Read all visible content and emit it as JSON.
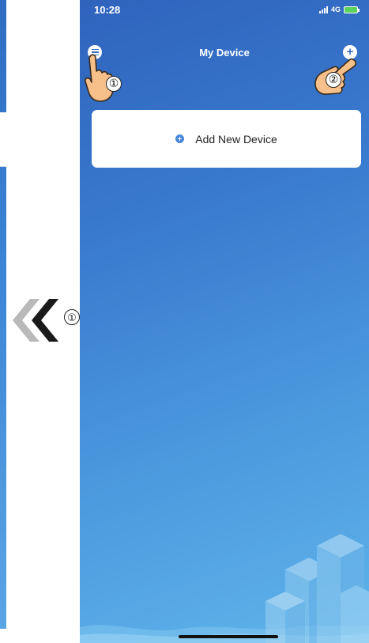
{
  "status_bar": {
    "time": "10:28",
    "network": "4G"
  },
  "header": {
    "title": "My Device",
    "menu_icon": "menu-icon",
    "add_icon": "plus-icon"
  },
  "main": {
    "add_device_label": "Add New Device",
    "add_device_icon": "plus-circle-icon"
  },
  "annotations": {
    "left_arrow_number": "①",
    "hand_1_number": "①",
    "hand_2_number": "②"
  },
  "colors": {
    "background_top": "#2f63bd",
    "background_bottom": "#5fb4ea",
    "card": "#ffffff",
    "accent": "#4a86d8"
  }
}
